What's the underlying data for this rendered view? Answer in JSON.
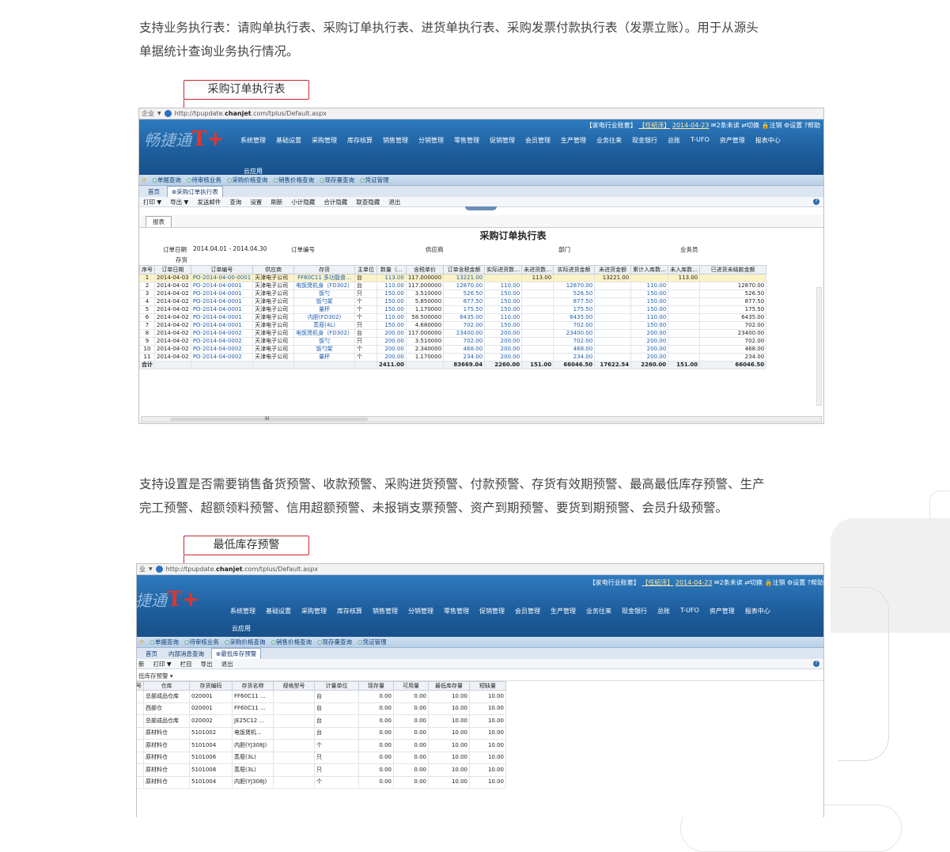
{
  "para1": {
    "line1": "支持业务执行表：请购单执行表、采购订单执行表、进货单执行表、采购发票付款执行表（发票立账）。用于从源头",
    "line2": "单据统计查询业务执行情况。"
  },
  "callout1": "采购订单执行表",
  "para2": {
    "line1": "支持设置是否需要销售备货预警、收款预警、采购进货预警、付款预警、存货有效期预警、最高最低库存预警、生产",
    "line2": "完工预警、超额领料预警、信用超额预警、未报销支票预警、资产到期预警、要货到期预警、会员升级预警。"
  },
  "callout2": "最低库存预警",
  "colors": {
    "accent": "#c9262c",
    "banner": "#1e5f9e",
    "highlight_row": "#fbf3c5"
  },
  "app1": {
    "address": {
      "prefix": "企业",
      "url_pre": "http://tpupdate.",
      "url_bold": "chanjet",
      "url_post": ".com/tplus/Default.aspx"
    },
    "logo": {
      "text": "畅捷通",
      "mark": "T+"
    },
    "toplinks": {
      "account": "【家电行业账套】",
      "user": "【任紹泽】",
      "date": "2014-04-23",
      "unread": "2条未读",
      "switch": "切换",
      "logout": "注销",
      "settings": "设置",
      "help": "帮助"
    },
    "menu": [
      "系统管理",
      "基础设置",
      "采购管理",
      "库存核算",
      "销售管理",
      "分销管理",
      "零售管理",
      "促销管理",
      "会员管理",
      "生产管理",
      "业务往来",
      "现金银行",
      "总账",
      "T-UFO",
      "资产管理",
      "报表中心"
    ],
    "cloud": "云应用",
    "quick": [
      "单据查询",
      "待审核业务",
      "采购价格查询",
      "销售价格查询",
      "现存量查询",
      "凭证管理"
    ],
    "tabs": [
      "首页",
      "采购订单执行表"
    ],
    "toolbar": [
      "打印 ▼",
      "导出 ▼",
      "发送邮件",
      "查询",
      "设置",
      "刷新",
      "小计隐藏",
      "合计隐藏",
      "联查隐藏",
      "退出"
    ],
    "subtab": "报表",
    "report_title": "采购订单执行表",
    "filters": {
      "date_label": "订单日期",
      "date_value": "2014.04.01 - 2014.04.30",
      "order_no": "订单编号",
      "supplier": "供应商",
      "dept": "部门",
      "salesman": "业务员",
      "inventory": "存货"
    },
    "columns": [
      "序号",
      "订单日期",
      "订单编号",
      "供应商",
      "存货",
      "主单位",
      "数量（…",
      "含税单价",
      "订单含税金额",
      "实际进货数…",
      "未进货数…",
      "实际进货金额",
      "未进货金额",
      "累计入库数…",
      "未入库数…",
      "已进货未结款金额"
    ],
    "rows": [
      [
        "1",
        "2014-04-03",
        "PO-2014-04-00-0001",
        "天津电子公司",
        "FF60C11 多功能食…",
        "台",
        "113.00",
        "117.000000",
        "13221.00",
        "",
        "113.00",
        "",
        "13221.00",
        "",
        "113.00",
        ""
      ],
      [
        "2",
        "2014-04-02",
        "PO-2014-04-0001",
        "天津电子公司",
        "电饭煲机身（FD302）",
        "台",
        "110.00",
        "117.000000",
        "12870.00",
        "110.00",
        "",
        "12870.00",
        "",
        "110.00",
        "",
        "12870.00"
      ],
      [
        "3",
        "2014-04-02",
        "PO-2014-04-0001",
        "天津电子公司",
        "饭勺",
        "只",
        "150.00",
        "3.510000",
        "526.50",
        "150.00",
        "",
        "526.50",
        "",
        "150.00",
        "",
        "526.50"
      ],
      [
        "4",
        "2014-04-02",
        "PO-2014-04-0001",
        "天津电子公司",
        "饭勺架",
        "个",
        "150.00",
        "5.850000",
        "877.50",
        "150.00",
        "",
        "877.50",
        "",
        "150.00",
        "",
        "877.50"
      ],
      [
        "5",
        "2014-04-02",
        "PO-2014-04-0001",
        "天津电子公司",
        "量杯",
        "个",
        "150.00",
        "1.170000",
        "175.50",
        "150.00",
        "",
        "175.50",
        "",
        "150.00",
        "",
        "175.50"
      ],
      [
        "6",
        "2014-04-02",
        "PO-2014-04-0001",
        "天津电子公司",
        "内胆(FD302)",
        "个",
        "110.00",
        "58.500000",
        "6435.00",
        "110.00",
        "",
        "6435.00",
        "",
        "110.00",
        "",
        "6435.00"
      ],
      [
        "7",
        "2014-04-02",
        "PO-2014-04-0001",
        "天津电子公司",
        "蒸屉(4L)",
        "只",
        "150.00",
        "4.680000",
        "702.00",
        "150.00",
        "",
        "702.00",
        "",
        "150.00",
        "",
        "702.00"
      ],
      [
        "8",
        "2014-04-02",
        "PO-2014-04-0002",
        "天津电子公司",
        "电饭煲机身（FD302）",
        "台",
        "200.00",
        "117.000000",
        "23400.00",
        "200.00",
        "",
        "23400.00",
        "",
        "200.00",
        "",
        "23400.00"
      ],
      [
        "9",
        "2014-04-02",
        "PO-2014-04-0002",
        "天津电子公司",
        "饭勺",
        "只",
        "200.00",
        "3.510000",
        "702.00",
        "200.00",
        "",
        "702.00",
        "",
        "200.00",
        "",
        "702.00"
      ],
      [
        "10",
        "2014-04-02",
        "PO-2014-04-0002",
        "天津电子公司",
        "饭勺架",
        "个",
        "200.00",
        "2.340000",
        "468.00",
        "200.00",
        "",
        "468.00",
        "",
        "200.00",
        "",
        "468.00"
      ],
      [
        "11",
        "2014-04-02",
        "PO-2014-04-0002",
        "天津电子公司",
        "量杯",
        "个",
        "200.00",
        "1.170000",
        "234.00",
        "200.00",
        "",
        "234.00",
        "",
        "200.00",
        "",
        "234.00"
      ]
    ],
    "total": [
      "合计",
      "",
      "",
      "",
      "",
      "",
      "2411.00",
      "",
      "83669.04",
      "2260.00",
      "151.00",
      "66046.50",
      "17622.54",
      "2260.00",
      "151.00",
      "66046.50"
    ],
    "scroll_mark": "III"
  },
  "app2": {
    "address": {
      "prefix": "业",
      "url_pre": "http://tpupdate.",
      "url_bold": "chanjet",
      "url_post": ".com/tplus/Default.aspx"
    },
    "logo": {
      "text": "捷通",
      "mark": "T+"
    },
    "toplinks": {
      "account": "【家电行业账套】",
      "user": "【任紹泽】",
      "date": "2014-04-23",
      "unread": "2条未读",
      "switch": "切换",
      "logout": "注销",
      "settings": "设置",
      "help": "帮助"
    },
    "menu": [
      "系统管理",
      "基础设置",
      "采购管理",
      "库存核算",
      "销售管理",
      "分销管理",
      "零售管理",
      "促销管理",
      "会员管理",
      "生产管理",
      "业务往来",
      "现金银行",
      "总账",
      "T-UFO",
      "资产管理",
      "报表中心"
    ],
    "cloud": "云应用",
    "quick": [
      "单据查询",
      "待审核业务",
      "采购价格查询",
      "销售价格查询",
      "现存量查询",
      "凭证管理"
    ],
    "tabs": [
      "首页",
      "内部消息查询",
      "最低库存预警"
    ],
    "toolbar": [
      "新",
      "打印 ▼",
      "栏目",
      "导出",
      "退出"
    ],
    "dropdown": "低库存预警",
    "columns": [
      "号",
      "仓库",
      "存货编码",
      "存货名称",
      "规格型号",
      "计量单位",
      "现存量",
      "可用量",
      "最低库存量",
      "短缺量"
    ],
    "rows": [
      [
        "",
        "总部成品仓库",
        "020001",
        "FF60C11 ...",
        "",
        "台",
        "0.00",
        "0.00",
        "10.00",
        "10.00"
      ],
      [
        "",
        "西部仓",
        "020001",
        "FF60C11 ...",
        "",
        "台",
        "0.00",
        "0.00",
        "10.00",
        "10.00"
      ],
      [
        "",
        "总部成品仓库",
        "020002",
        "JE25C12 ...",
        "",
        "台",
        "0.00",
        "0.00",
        "10.00",
        "10.00"
      ],
      [
        "",
        "原材料仓",
        "5101002",
        "电饭煲机...",
        "",
        "台",
        "0.00",
        "0.00",
        "10.00",
        "10.00"
      ],
      [
        "",
        "原材料仓",
        "5101004",
        "内胆(YJ308J)",
        "",
        "个",
        "0.00",
        "0.00",
        "10.00",
        "10.00"
      ],
      [
        "",
        "原材料仓",
        "5101006",
        "蒸屉(3L)",
        "",
        "只",
        "0.00",
        "0.00",
        "10.00",
        "10.00"
      ],
      [
        "",
        "原材料仓",
        "5101008",
        "蒸屉(3L)",
        "",
        "只",
        "0.00",
        "0.00",
        "10.00",
        "10.00"
      ],
      [
        "",
        "原材料仓",
        "5101004",
        "内胆(YJ308J)",
        "",
        "个",
        "0.00",
        "0.00",
        "10.00",
        "10.00"
      ]
    ]
  }
}
